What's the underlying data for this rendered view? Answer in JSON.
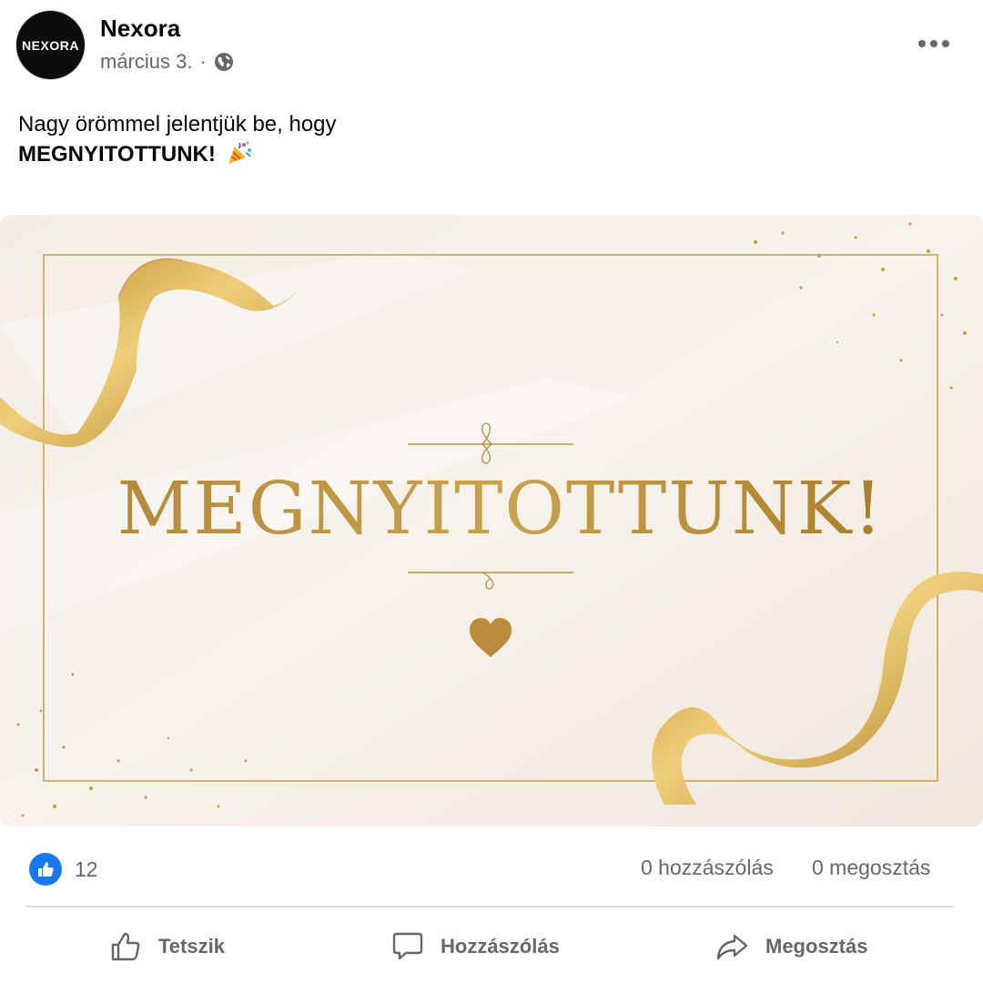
{
  "post": {
    "page_name": "Nexora",
    "avatar_text": "NEXORA",
    "date": "március 3.",
    "separator": "·",
    "audience_icon": "globe-icon",
    "more_icon": "more-options-icon",
    "text_line1": "Nagy örömmel jelentjük be, hogy",
    "text_line2": "MEGNYITOTTUNK!",
    "emoji": "party-popper"
  },
  "image": {
    "headline": "MEGNYITOTTUNK!",
    "colors": {
      "background": "#f5efe7",
      "gold": "#c49a3d",
      "frame": "#caa25a"
    }
  },
  "stats": {
    "like_count": "12",
    "comments": "0 hozzászólás",
    "shares": "0 megosztás"
  },
  "actions": {
    "like": "Tetszik",
    "comment": "Hozzászólás",
    "share": "Megosztás"
  }
}
